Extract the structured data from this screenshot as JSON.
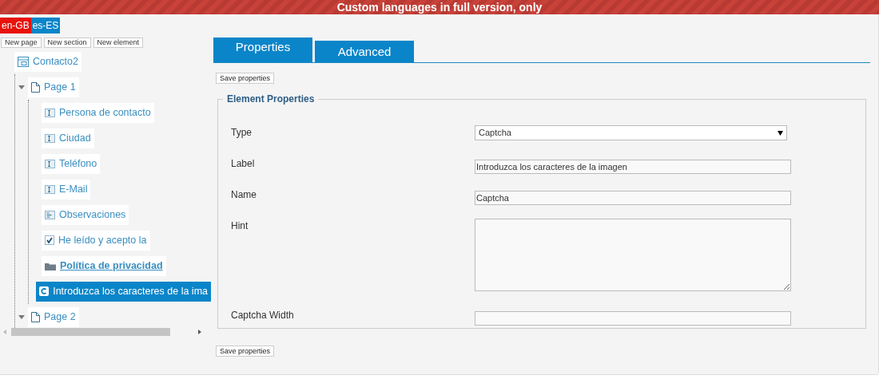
{
  "banner": {
    "text": "Custom languages in full version, only"
  },
  "languages": [
    {
      "label": "en-GB",
      "color": "#e8120c"
    },
    {
      "label": "es-ES",
      "color": "#0a85c9"
    }
  ],
  "toolbar": [
    "New page",
    "New section",
    "New element"
  ],
  "tree": [
    {
      "label": "Contacto2",
      "kind": "form",
      "selected": false,
      "children": [
        {
          "label": "Page 1",
          "kind": "page",
          "selected": false,
          "expanded": true,
          "children": [
            {
              "label": "Persona de contacto",
              "kind": "text",
              "selected": false
            },
            {
              "label": "Ciudad",
              "kind": "text",
              "selected": false
            },
            {
              "label": "Teléfono",
              "kind": "text",
              "selected": false
            },
            {
              "label": "E-Mail",
              "kind": "text",
              "selected": false
            },
            {
              "label": "Observaciones",
              "kind": "textarea",
              "selected": false
            },
            {
              "label": "He leído y acepto la",
              "kind": "checkbox",
              "selected": false
            },
            {
              "label": "Política de privacidad",
              "kind": "link",
              "selected": false
            },
            {
              "label": "Introduzca los caracteres de la ima",
              "kind": "captcha",
              "selected": true
            }
          ]
        },
        {
          "label": "Page 2",
          "kind": "page",
          "selected": false,
          "expanded": true
        }
      ]
    }
  ],
  "tabs": [
    {
      "label": "Properties",
      "selected": true
    },
    {
      "label": "Advanced",
      "selected": false
    }
  ],
  "save_buttons": [
    "Save properties",
    "Save properties"
  ],
  "fieldset": {
    "legend": "Element Properties",
    "fields": [
      {
        "label": "Type",
        "kind": "select",
        "value": "Captcha"
      },
      {
        "label": "Label",
        "kind": "text",
        "value": "Introduzca los caracteres de la imagen"
      },
      {
        "label": "Name",
        "kind": "text",
        "value": "Captcha"
      },
      {
        "label": "Hint",
        "kind": "textarea"
      },
      {
        "label": "Captcha Width",
        "kind": "text"
      }
    ]
  }
}
